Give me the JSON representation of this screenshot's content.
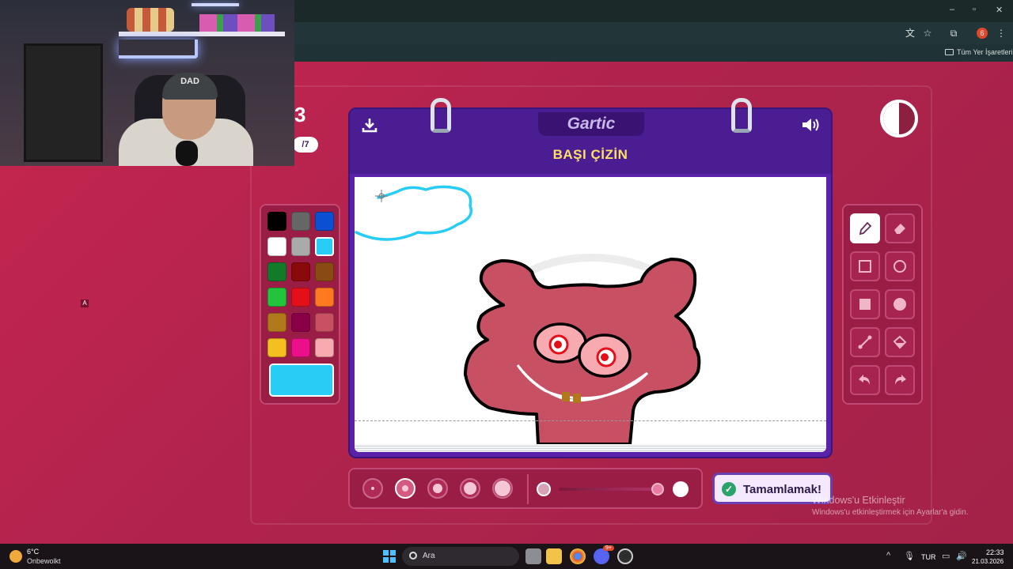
{
  "browser": {
    "bookmarks_label": "Tüm Yer İşaretleri",
    "profile_badge": "6",
    "window_controls": [
      "–",
      "▫",
      "✕"
    ]
  },
  "webcam": {
    "cap_text": "DAD"
  },
  "game": {
    "logo": "Gartic",
    "instruction": "BAŞI ÇİZİN",
    "timer": "3",
    "round": "/7",
    "done_label": "Tamamlamak!"
  },
  "palette": {
    "colors": [
      "#000000",
      "#666666",
      "#0b50d0",
      "#ffffff",
      "#aaaaaa",
      "#28cdf5",
      "#137a2a",
      "#8a0a0a",
      "#8a4a14",
      "#22c43d",
      "#e3101a",
      "#ff7a1f",
      "#b07a1c",
      "#8a0048",
      "#c75063",
      "#f4c020",
      "#ec0f8a",
      "#f7aab0"
    ],
    "selected_color": "#28cdf5"
  },
  "tools": [
    "pencil",
    "eraser",
    "rectangle-outline",
    "ellipse-outline",
    "rectangle-filled",
    "ellipse-filled",
    "line",
    "fill-bucket",
    "undo",
    "redo"
  ],
  "brush": {
    "selected_size_index": 1,
    "sizes": 5
  },
  "windows": {
    "activate_title": "Windows'u Etkinleştir",
    "activate_sub": "Windows'u etkinleştirmek için Ayarlar'a gidin."
  },
  "overlay": {
    "marker": "A"
  },
  "taskbar": {
    "weather_temp": "6°C",
    "weather_desc": "Onbewolkt",
    "search": "Ara",
    "lang": "TUR",
    "time": "22:33",
    "date": "21.03.2026",
    "chat_badge": "9+"
  }
}
